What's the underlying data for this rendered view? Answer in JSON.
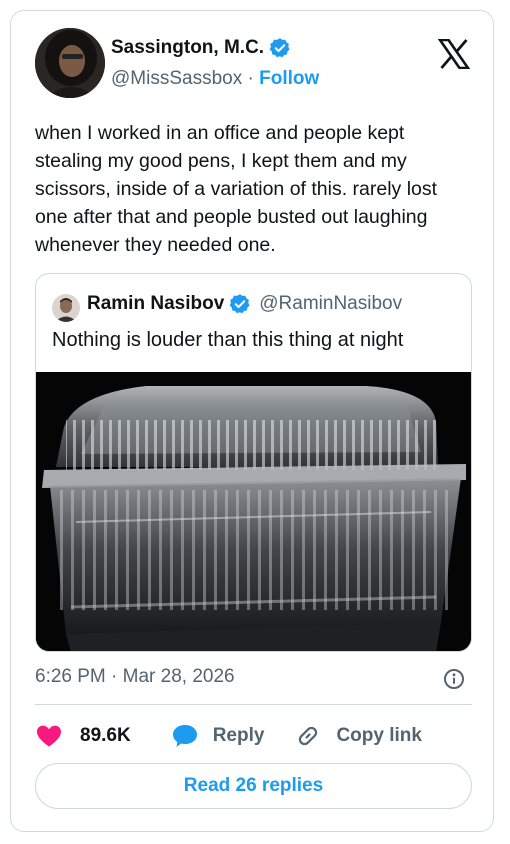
{
  "tweet": {
    "author": {
      "name": "Sassington, M.C.",
      "handle": "@MissSassbox",
      "separator": "·",
      "follow_label": "Follow",
      "verified": true
    },
    "text": "when I worked in an office and people kept stealing my good pens, I kept them and my scissors, inside of a variation of this. rarely lost one after that and people busted out laughing whenever they needed one.",
    "timestamp": "6:26 PM · Mar 28, 2026",
    "likes_count": "89.6K",
    "reply_label": "Reply",
    "copy_link_label": "Copy link",
    "read_replies_label": "Read 26 replies"
  },
  "quote": {
    "author": {
      "name": "Ramin Nasibov",
      "handle": "@RaminNasibov",
      "verified": true
    },
    "text": "Nothing is louder than this thing at night",
    "media_subject": "clear plastic clamshell container"
  },
  "colors": {
    "accent": "#1d9bf0",
    "like": "#f91880",
    "secondary_text": "#536471",
    "border": "#cfd9de"
  },
  "icons": [
    "verified-badge-icon",
    "x-logo-icon",
    "info-icon",
    "heart-icon",
    "reply-bubble-icon",
    "link-icon"
  ]
}
